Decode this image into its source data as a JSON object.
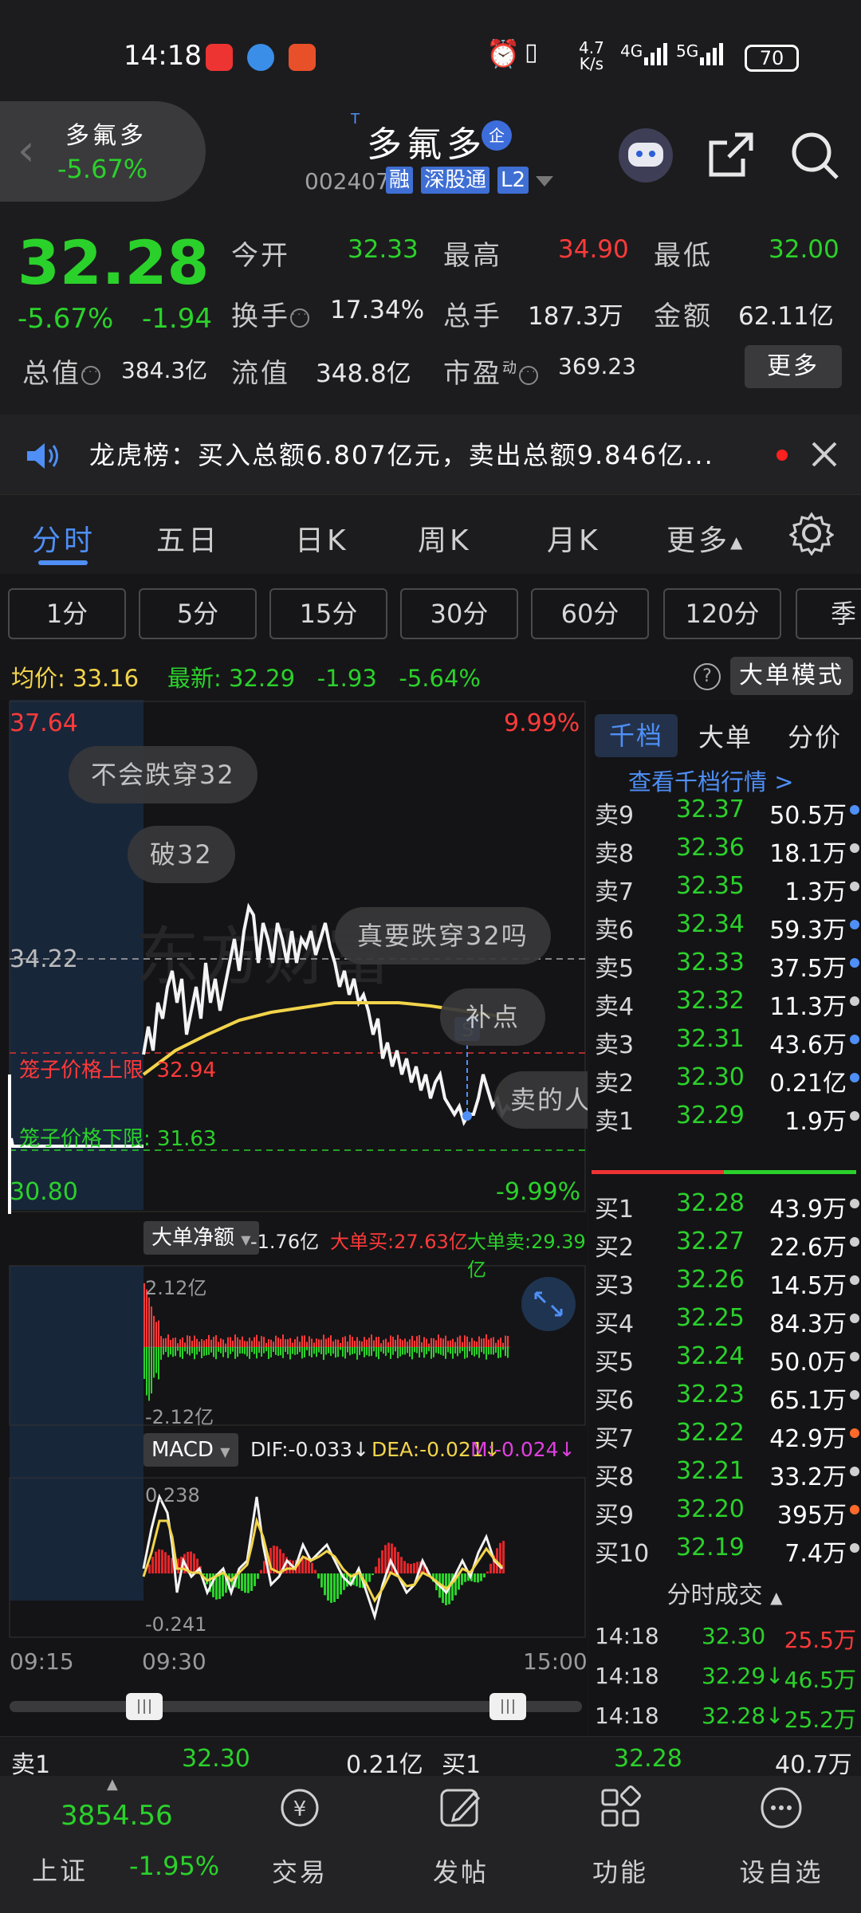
{
  "status_bar": {
    "time": "14:18",
    "speed_top": "4.7",
    "speed_bottom": "K/s",
    "net1": "4G",
    "net2": "5G",
    "battery": "70"
  },
  "header": {
    "back_name": "多氟多",
    "back_change": "-5.67%",
    "title": "多氟多",
    "title_sup": "T",
    "qi_badge": "企",
    "code": "002407",
    "tag_rong": "融",
    "tag_hk": "深股通",
    "tag_l2": "L2"
  },
  "quote": {
    "price": "32.28",
    "change_pct": "-5.67%",
    "change": "-1.94",
    "open_label": "今开",
    "open": "32.33",
    "high_label": "最高",
    "high": "34.90",
    "low_label": "最低",
    "low": "32.00",
    "turnover_label": "换手",
    "turnover": "17.34%",
    "volume_label": "总手",
    "volume": "187.3万",
    "amount_label": "金额",
    "amount": "62.11亿",
    "mktcap_label": "总值",
    "mktcap": "384.3亿",
    "float_label": "流值",
    "float": "348.8亿",
    "pe_label": "市盈",
    "pe_sup": "动",
    "pe": "369.23",
    "more": "更多"
  },
  "ticker": {
    "text": "龙虎榜：买入总额6.807亿元，卖出总额9.846亿..."
  },
  "period_tabs": [
    "分时",
    "五日",
    "日K",
    "周K",
    "月K",
    "更多"
  ],
  "interval_buttons": [
    "1分",
    "5分",
    "15分",
    "30分",
    "60分",
    "120分",
    "季"
  ],
  "info_line": {
    "avg_label": "均价:",
    "avg": "33.16",
    "latest_label": "最新:",
    "latest": "32.29",
    "latest_chg": "-1.93",
    "latest_pct": "-5.64%",
    "big_mode": "大单模式"
  },
  "intraday_chart": {
    "top_price": "37.64",
    "top_pct": "9.99%",
    "bottom_price": "30.80",
    "bottom_pct": "-9.99%",
    "ref_price": "34.22",
    "cage_upper_label": "笼子价格上限",
    "cage_upper": "32.94",
    "cage_lower_label": "笼子价格下限:",
    "cage_lower": "31.63",
    "watermark": "东方财富",
    "marker": "S",
    "bubbles": [
      "不会跌穿32",
      "破32",
      "真要跌穿32吗",
      "补点",
      "卖的人"
    ]
  },
  "bigorder": {
    "selector": "大单净额",
    "net": "-1.76亿",
    "buy_label": "大单买:",
    "buy": "27.63亿",
    "sell_label": "大单卖:",
    "sell": "29.39亿",
    "top": "2.12亿",
    "bottom": "-2.12亿"
  },
  "macd": {
    "selector": "MACD",
    "dif": "DIF:-0.033",
    "dea": "DEA:-0.021",
    "m": "M:-0.024",
    "top": "0.238",
    "bottom": "-0.241"
  },
  "time_axis": [
    "09:15",
    "09:30",
    "15:00"
  ],
  "order_book": {
    "tabs": [
      "千档",
      "大单",
      "分价"
    ],
    "view_link": "查看千档行情 >",
    "asks": [
      {
        "label": "卖9",
        "price": "32.37",
        "vol": "50.5万",
        "dot": "#4f8ff7"
      },
      {
        "label": "卖8",
        "price": "32.36",
        "vol": "18.1万",
        "dot": "#cfcfcf"
      },
      {
        "label": "卖7",
        "price": "32.35",
        "vol": "1.3万",
        "dot": "#cfcfcf"
      },
      {
        "label": "卖6",
        "price": "32.34",
        "vol": "59.3万",
        "dot": "#4f8ff7"
      },
      {
        "label": "卖5",
        "price": "32.33",
        "vol": "37.5万",
        "dot": "#4f8ff7"
      },
      {
        "label": "卖4",
        "price": "32.32",
        "vol": "11.3万",
        "dot": "#cfcfcf"
      },
      {
        "label": "卖3",
        "price": "32.31",
        "vol": "43.6万",
        "dot": "#4f8ff7"
      },
      {
        "label": "卖2",
        "price": "32.30",
        "vol": "0.21亿",
        "dot": "#4f8ff7"
      },
      {
        "label": "卖1",
        "price": "32.29",
        "vol": "1.9万",
        "dot": "#cfcfcf"
      }
    ],
    "bids": [
      {
        "label": "买1",
        "price": "32.28",
        "vol": "43.9万",
        "dot": "#cfcfcf"
      },
      {
        "label": "买2",
        "price": "32.27",
        "vol": "22.6万",
        "dot": "#cfcfcf"
      },
      {
        "label": "买3",
        "price": "32.26",
        "vol": "14.5万",
        "dot": "#cfcfcf"
      },
      {
        "label": "买4",
        "price": "32.25",
        "vol": "84.3万",
        "dot": "#cfcfcf"
      },
      {
        "label": "买5",
        "price": "32.24",
        "vol": "50.0万",
        "dot": "#cfcfcf"
      },
      {
        "label": "买6",
        "price": "32.23",
        "vol": "65.1万",
        "dot": "#cfcfcf"
      },
      {
        "label": "买7",
        "price": "32.22",
        "vol": "42.9万",
        "dot": "#ff6a2b"
      },
      {
        "label": "买8",
        "price": "32.21",
        "vol": "33.2万",
        "dot": "#cfcfcf"
      },
      {
        "label": "买9",
        "price": "32.20",
        "vol": "395万",
        "dot": "#ff6a2b"
      },
      {
        "label": "买10",
        "price": "32.19",
        "vol": "7.4万",
        "dot": "#cfcfcf"
      }
    ],
    "trades_title": "分时成交",
    "trades": [
      {
        "time": "14:18",
        "price": "32.30",
        "arrow": "",
        "vol": "25.5万",
        "color": "#ff3a3a"
      },
      {
        "time": "14:18",
        "price": "32.29",
        "arrow": "↓",
        "vol": "46.5万",
        "color": "#2bd12b"
      },
      {
        "time": "14:18",
        "price": "32.28",
        "arrow": "↓",
        "vol": "25.2万",
        "color": "#2bd12b"
      }
    ]
  },
  "bottom_quote": {
    "ask_label": "卖1",
    "ask_price": "32.30",
    "ask_vol": "0.21亿",
    "bid_label": "买1",
    "bid_price": "32.28",
    "bid_vol": "40.7万"
  },
  "nav": {
    "index_value": "3854.56",
    "index_name": "上证",
    "index_pct": "-1.95%",
    "items": [
      "交易",
      "发帖",
      "功能",
      "设自选"
    ]
  },
  "colors": {
    "up": "#ff3a3a",
    "down": "#2bd12b",
    "accent": "#4f8ff7",
    "avg_line": "#f2d44a"
  }
}
